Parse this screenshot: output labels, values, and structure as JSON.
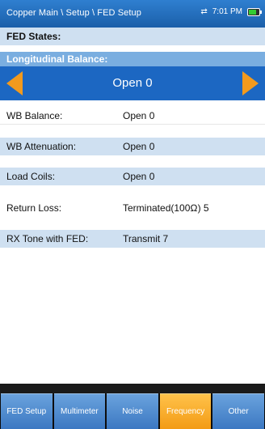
{
  "header": {
    "breadcrumb": "Copper Main \\ Setup \\ FED Setup",
    "time": "7:01 PM",
    "sync_icon": "swap-arrows-icon",
    "battery_icon": "battery-icon"
  },
  "fed_states": {
    "label": "FED States:"
  },
  "longitudinal_balance": {
    "label": "Longitudinal Balance:",
    "value": "Open 0",
    "left_icon": "arrow-left-icon",
    "right_icon": "arrow-right-icon"
  },
  "rows": [
    {
      "label": "WB Balance:",
      "value": "Open 0"
    },
    {
      "label": "WB Attenuation:",
      "value": "Open 0"
    },
    {
      "label": "Load Coils:",
      "value": "Open 0"
    },
    {
      "label": "Return Loss:",
      "value": "Terminated(100Ω) 5"
    },
    {
      "label": "RX Tone with FED:",
      "value": "Transmit 7"
    }
  ],
  "tabs": [
    {
      "label": "FED Setup",
      "active": false
    },
    {
      "label": "Multimeter",
      "active": false
    },
    {
      "label": "Noise",
      "active": false
    },
    {
      "label": "Frequency",
      "active": true
    },
    {
      "label": "Other",
      "active": false
    }
  ],
  "colors": {
    "accent": "#1c67c2",
    "active_tab": "#f39b15",
    "shaded_row": "#cfe0f1"
  }
}
